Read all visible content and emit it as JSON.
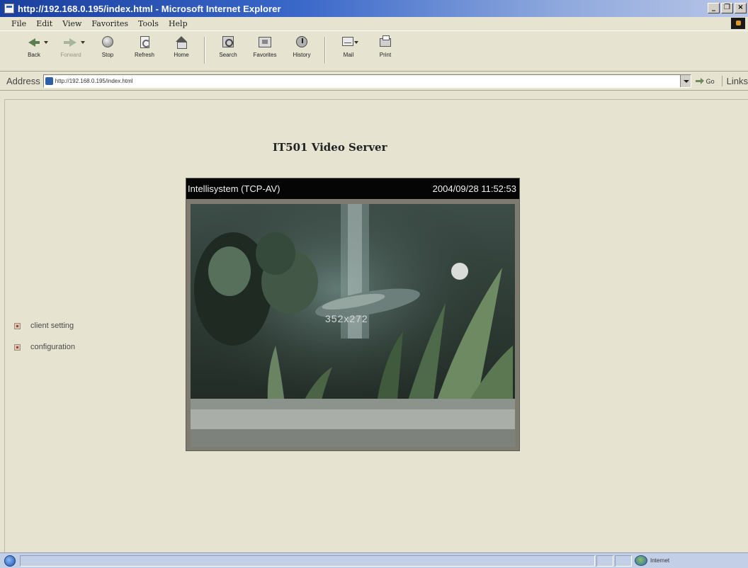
{
  "window": {
    "title": "http://192.168.0.195/index.html - Microsoft Internet Explorer",
    "controls": [
      "_",
      "×"
    ]
  },
  "menu": [
    "File",
    "Edit",
    "View",
    "Favorites",
    "Tools",
    "Help"
  ],
  "toolbar": {
    "back": "Back",
    "forward": "Forward",
    "stop": "Stop",
    "refresh": "Refresh",
    "home": "Home",
    "search": "Search",
    "favorites": "Favorites",
    "history": "History",
    "mail": "Mail",
    "print": "Print"
  },
  "address": {
    "label": "Address",
    "url": "http://192.168.0.195/index.html",
    "go": "Go",
    "links": "Links"
  },
  "page": {
    "title": "IT501 Video Server",
    "video": {
      "caption": "Intellisystem (TCP-AV)",
      "timestamp": "2004/09/28 11:52:53",
      "overlay": "352x272"
    },
    "links": [
      "client setting",
      "configuration"
    ]
  },
  "status": {
    "zone": "Internet"
  },
  "colors": {
    "titlebar": "#1b3f9e",
    "page_bg": "#e6e3d1",
    "statusbar": "#c3cfe6"
  }
}
